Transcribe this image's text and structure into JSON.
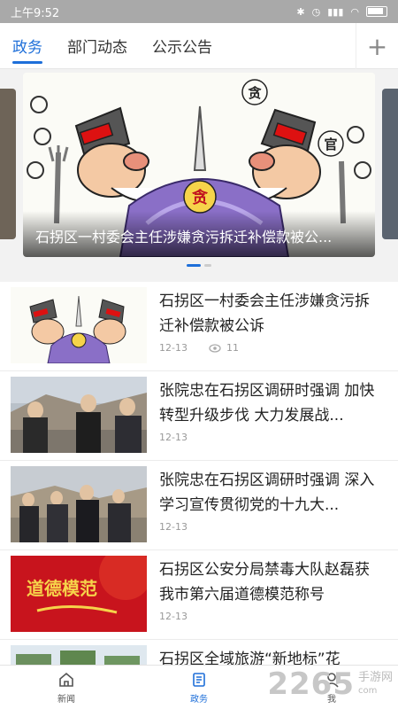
{
  "status": {
    "time": "上午9:52"
  },
  "tabs": [
    {
      "label": "政务"
    },
    {
      "label": "部门动态"
    },
    {
      "label": "公示公告"
    }
  ],
  "carousel": {
    "caption": "石拐区一村委会主任涉嫌贪污拆迁补偿款被公...",
    "cartoon_text": {
      "left_hat": "贪",
      "right_hat": "官",
      "pile": "贪"
    }
  },
  "news": [
    {
      "title": "石拐区一村委会主任涉嫌贪污拆迁补偿款被公诉",
      "date": "12-13",
      "views": "11"
    },
    {
      "title": "张院忠在石拐区调研时强调 加快转型升级步伐 大力发展战...",
      "date": "12-13"
    },
    {
      "title": "张院忠在石拐区调研时强调 深入学习宣传贯彻党的十九大...",
      "date": "12-13"
    },
    {
      "title": "石拐区公安分局禁毒大队赵磊获我市第六届道德模范称号",
      "date": "12-13",
      "thumb_text": "道德模范"
    },
    {
      "title": "石拐区全域旅游“新地标”花"
    }
  ],
  "nav": [
    {
      "label": "新闻",
      "icon": "home-icon"
    },
    {
      "label": "政务",
      "icon": "document-icon"
    },
    {
      "label": "我",
      "icon": "user-icon"
    }
  ],
  "watermark": {
    "number": "2265",
    "text1": "手游网",
    "text2": "com"
  },
  "colors": {
    "accent": "#1e6fd9",
    "statusbar": "#a9a9a9"
  }
}
